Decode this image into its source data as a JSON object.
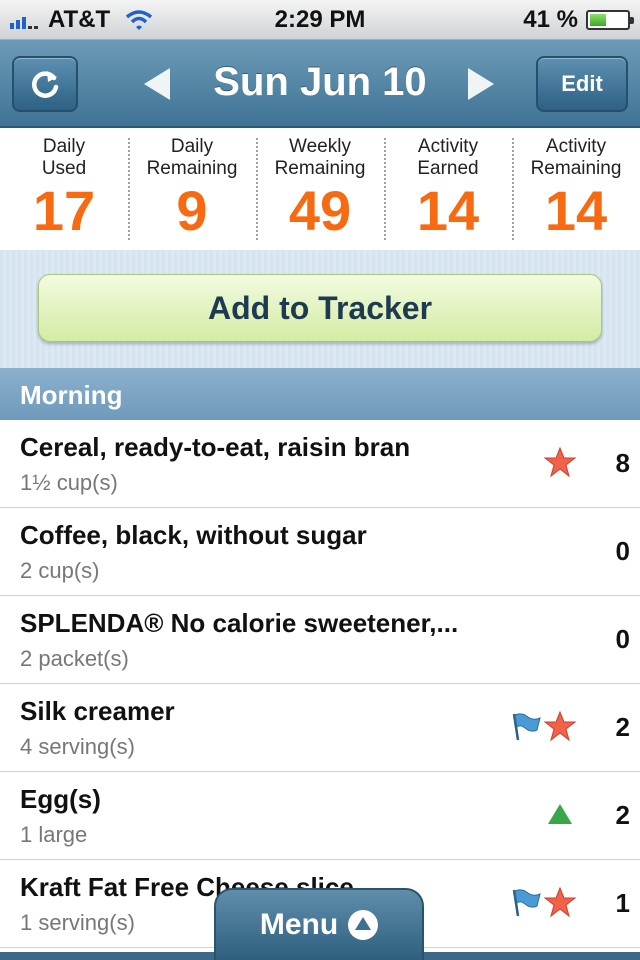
{
  "status": {
    "carrier": "AT&T",
    "time": "2:29 PM",
    "battery": "41 %",
    "battery_level": 0.41
  },
  "nav": {
    "title": "Sun Jun 10",
    "edit_label": "Edit",
    "icons": [
      "refresh-icon",
      "arrow-left-icon",
      "arrow-right-icon"
    ]
  },
  "stats": [
    {
      "label_line1": "Daily",
      "label_line2": "Used",
      "value": "17"
    },
    {
      "label_line1": "Daily",
      "label_line2": "Remaining",
      "value": "9"
    },
    {
      "label_line1": "Weekly",
      "label_line2": "Remaining",
      "value": "49"
    },
    {
      "label_line1": "Activity",
      "label_line2": "Earned",
      "value": "14"
    },
    {
      "label_line1": "Activity",
      "label_line2": "Remaining",
      "value": "14"
    }
  ],
  "add_button": "Add to Tracker",
  "section": "Morning",
  "foods": [
    {
      "name": "Cereal, ready-to-eat, raisin bran",
      "qty": "1½ cup(s)",
      "points": "8",
      "icons": [
        "star-icon"
      ]
    },
    {
      "name": "Coffee, black, without sugar",
      "qty": "2 cup(s)",
      "points": "0",
      "icons": []
    },
    {
      "name": "SPLENDA® No calorie sweetener,...",
      "qty": "2 packet(s)",
      "points": "0",
      "icons": []
    },
    {
      "name": "Silk creamer",
      "qty": "4 serving(s)",
      "points": "2",
      "icons": [
        "flag-icon",
        "star-icon"
      ]
    },
    {
      "name": "Egg(s)",
      "qty": "1 large",
      "points": "2",
      "icons": [
        "triangle-icon"
      ]
    },
    {
      "name": "Kraft Fat Free Cheese slice",
      "qty": "1 serving(s)",
      "points": "1",
      "icons": [
        "flag-icon",
        "star-icon"
      ]
    }
  ],
  "menu_label": "Menu",
  "colors": {
    "accent_orange": "#f86a11",
    "nav_blue": "#4f83a4",
    "star": "#f2614a",
    "flag": "#4a9ad4",
    "triangle": "#3aa64a"
  }
}
